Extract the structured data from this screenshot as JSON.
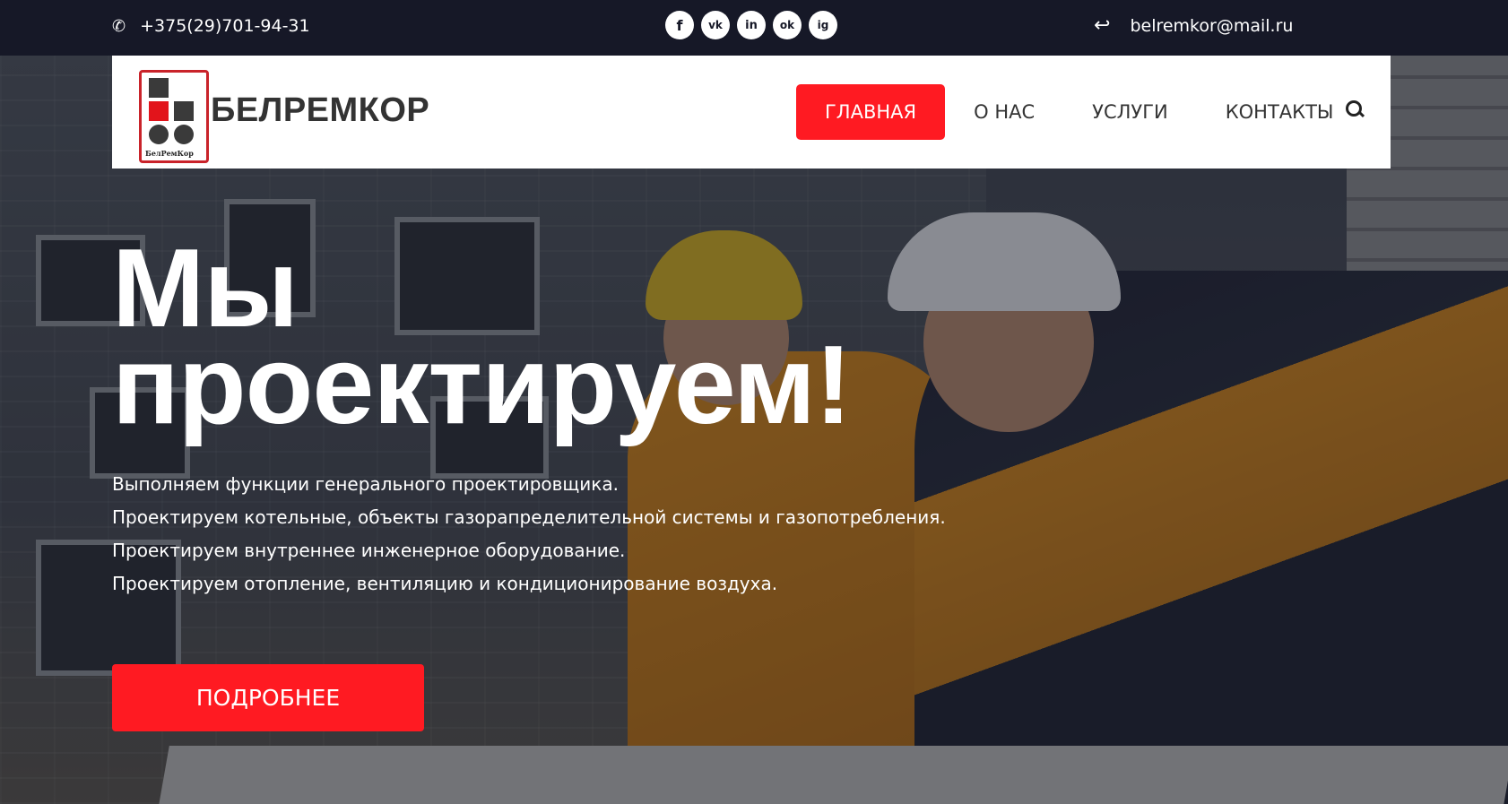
{
  "topbar": {
    "phone": "+375(29)701-94-31",
    "email": "belremkor@mail.ru",
    "socials": [
      "f",
      "vk",
      "in",
      "ok",
      "ig"
    ]
  },
  "header": {
    "brand": "БЕЛРЕМКОР",
    "logo_text": "БелРемКор",
    "nav": [
      "ГЛАВНАЯ",
      "О НАС",
      "УСЛУГИ",
      "КОНТАКТЫ"
    ]
  },
  "hero": {
    "headline_line1": "Мы",
    "headline_line2": "проектируем!",
    "lines": [
      "Выполняем функции генерального проектировщика.",
      "Проектируем котельные, объекты газорапределительной системы и газопотребления.",
      "Проектируем внутреннее инженерное оборудование.",
      "Проектируем отопление, вентиляцию и кондиционирование воздуха."
    ],
    "cta": "ПОДРОБНЕЕ"
  },
  "colors": {
    "accent": "#ff1a22",
    "topbar": "#161827"
  }
}
